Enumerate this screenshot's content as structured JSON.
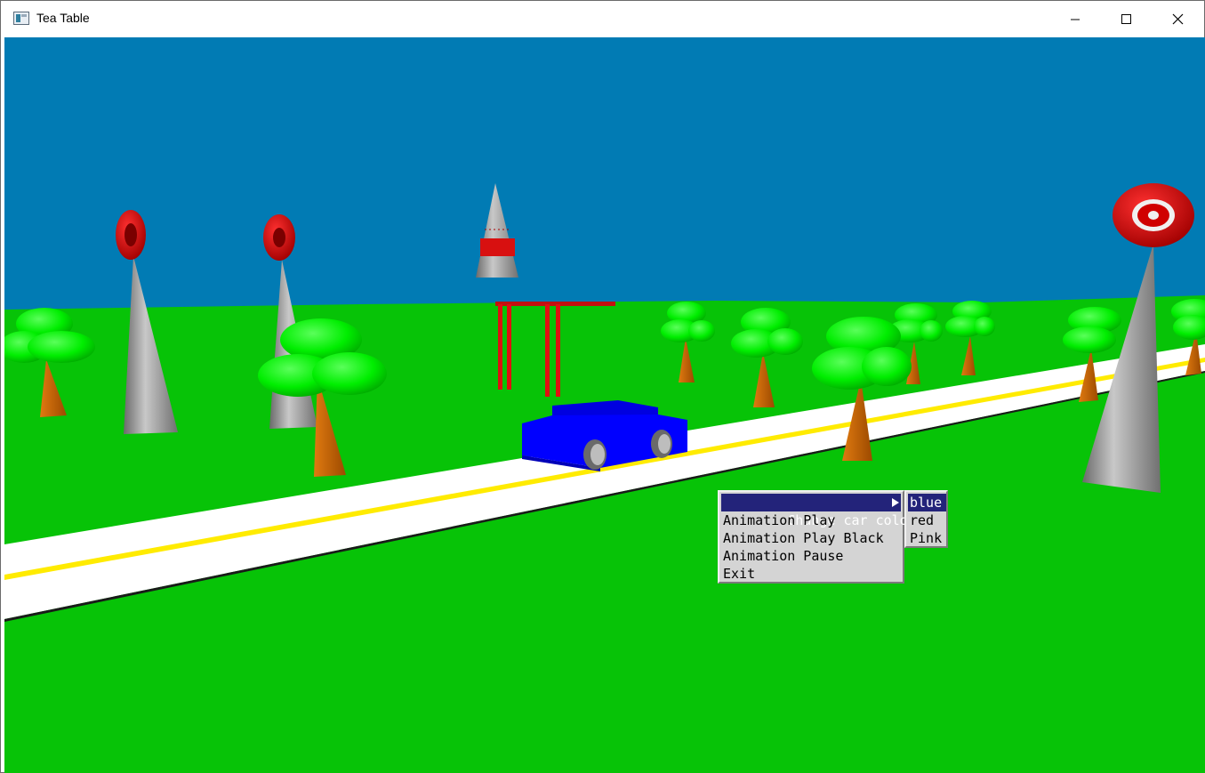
{
  "window": {
    "title": "Tea Table",
    "controls": [
      "minimize-icon",
      "maximize-icon",
      "close-icon"
    ]
  },
  "scene": {
    "sky_color": "#017bb4",
    "ground_color": "#07c307",
    "road_color": "#ffffff",
    "road_line_color": "#ffeb00",
    "car_color": "#0000ff",
    "tree_top_color": "#00f000",
    "trunk_color": "#c8660a",
    "ring_color": "#d40000",
    "cone_color": "#9a9a9a"
  },
  "context_menu": {
    "items": [
      {
        "label": "Change car colors",
        "has_submenu": true,
        "highlighted": true
      },
      {
        "label": "Animation Play"
      },
      {
        "label": "Animation Play Black"
      },
      {
        "label": "Animation Pause"
      },
      {
        "label": "Exit"
      }
    ],
    "submenu": {
      "items": [
        {
          "label": "blue",
          "highlighted": true
        },
        {
          "label": "red"
        },
        {
          "label": "Pink"
        }
      ]
    },
    "highlight_color": "#23237a"
  }
}
